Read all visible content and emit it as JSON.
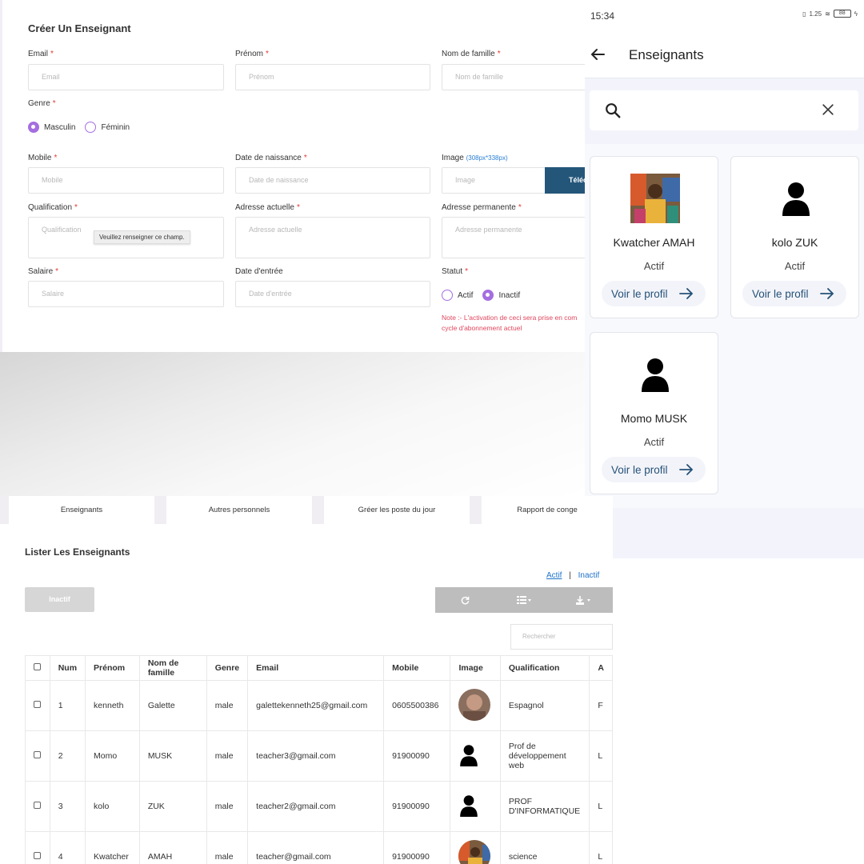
{
  "form": {
    "title": "Créer Un Enseignant",
    "required_mark": "*",
    "email_label": "Email",
    "email_placeholder": "Email",
    "firstname_label": "Prénom",
    "firstname_placeholder": "Prénom",
    "lastname_label": "Nom de famille",
    "lastname_placeholder": "Nom de famille",
    "gender_label": "Genre",
    "gender_male": "Masculin",
    "gender_female": "Féminin",
    "mobile_label": "Mobile",
    "mobile_placeholder": "Mobile",
    "birth_label": "Date de naissance",
    "birth_placeholder": "Date de naissance",
    "image_label": "Image",
    "image_hint": "(308px*338px)",
    "image_placeholder": "Image",
    "upload_label": "Téléc",
    "qualification_label": "Qualification",
    "qualification_placeholder": "Qualification",
    "tooltip": "Veuillez renseigner ce champ.",
    "current_address_label": "Adresse actuelle",
    "current_address_placeholder": "Adresse actuelle",
    "permanent_address_label": "Adresse permanente",
    "permanent_address_placeholder": "Adresse permanente",
    "salary_label": "Salaire",
    "salary_placeholder": "Salaire",
    "entry_label": "Date d'entrée",
    "entry_placeholder": "Date d'entrée",
    "status_label": "Statut",
    "status_active": "Actif",
    "status_inactive": "Inactif",
    "note": "Note :- L'activation de ceci sera prise en com cycle d'abonnement actuel"
  },
  "phone": {
    "time": "15:34",
    "net_speed": "1.25",
    "battery": "88",
    "title": "Enseignants",
    "cards": [
      {
        "name": "Kwatcher AMAH",
        "status": "Actif",
        "button": "Voir le profil"
      },
      {
        "name": "kolo ZUK",
        "status": "Actif",
        "button": "Voir le profil"
      },
      {
        "name": "Momo MUSK",
        "status": "Actif",
        "button": "Voir le profil"
      }
    ]
  },
  "tabs": [
    "Enseignants",
    "Autres personnels",
    "Gréer les poste du jour",
    "Rapport de conge"
  ],
  "list": {
    "title": "Lister Les Enseignants",
    "filter_active": "Actif",
    "filter_separator": "|",
    "filter_inactive": "Inactif",
    "inactive_button": "Inactif",
    "search_placeholder": "Rechercher",
    "columns": [
      "Num",
      "Prénom",
      "Nom de famille",
      "Genre",
      "Email",
      "Mobile",
      "Image",
      "Qualification",
      "A"
    ],
    "rows": [
      {
        "num": "1",
        "first": "kenneth",
        "last": "Galette",
        "gender": "male",
        "email": "galettekenneth25@gmail.com",
        "mobile": "0605500386",
        "qualification": "Espagnol",
        "extra": "F"
      },
      {
        "num": "2",
        "first": "Momo",
        "last": "MUSK",
        "gender": "male",
        "email": "teacher3@gmail.com",
        "mobile": "91900090",
        "qualification": "Prof de développement web",
        "extra": "L"
      },
      {
        "num": "3",
        "first": "kolo",
        "last": "ZUK",
        "gender": "male",
        "email": "teacher2@gmail.com",
        "mobile": "91900090",
        "qualification": "PROF D'INFORMATIQUE",
        "extra": "L"
      },
      {
        "num": "4",
        "first": "Kwatcher",
        "last": "AMAH",
        "gender": "male",
        "email": "teacher@gmail.com",
        "mobile": "91900090",
        "qualification": "science",
        "extra": "L"
      }
    ]
  },
  "colors": {
    "accent_purple": "#a56ee0",
    "brand_blue": "#24567a",
    "link_blue": "#1e73c9",
    "note_red": "#e0465e"
  }
}
